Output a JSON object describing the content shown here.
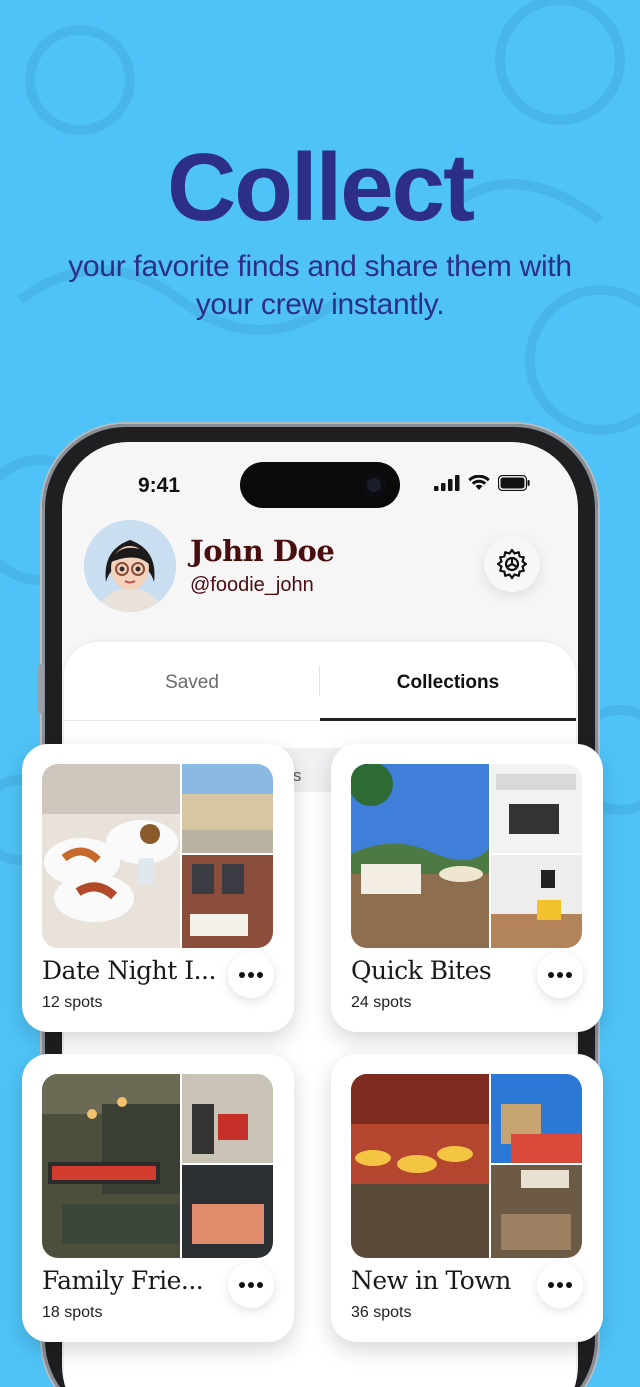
{
  "headline": {
    "title": "Collect",
    "subtitle": "your favorite finds and share them with your crew instantly."
  },
  "status_bar": {
    "time": "9:41"
  },
  "profile": {
    "name": "John Doe",
    "handle": "@foodie_john",
    "settings_icon": "gear-icon"
  },
  "tabs": [
    {
      "label": "Saved",
      "active": false
    },
    {
      "label": "Collections",
      "active": true
    }
  ],
  "obscured_text": "ons",
  "collections": [
    {
      "title": "Date Night I...",
      "count": "12 spots"
    },
    {
      "title": "Quick Bites",
      "count": "24 spots"
    },
    {
      "title": "Family Frie...",
      "count": "18 spots"
    },
    {
      "title": "New in Town",
      "count": "36 spots"
    }
  ],
  "colors": {
    "background": "#4fc3f7",
    "headline": "#2d2f87",
    "profile_name": "#4a0d0d"
  }
}
